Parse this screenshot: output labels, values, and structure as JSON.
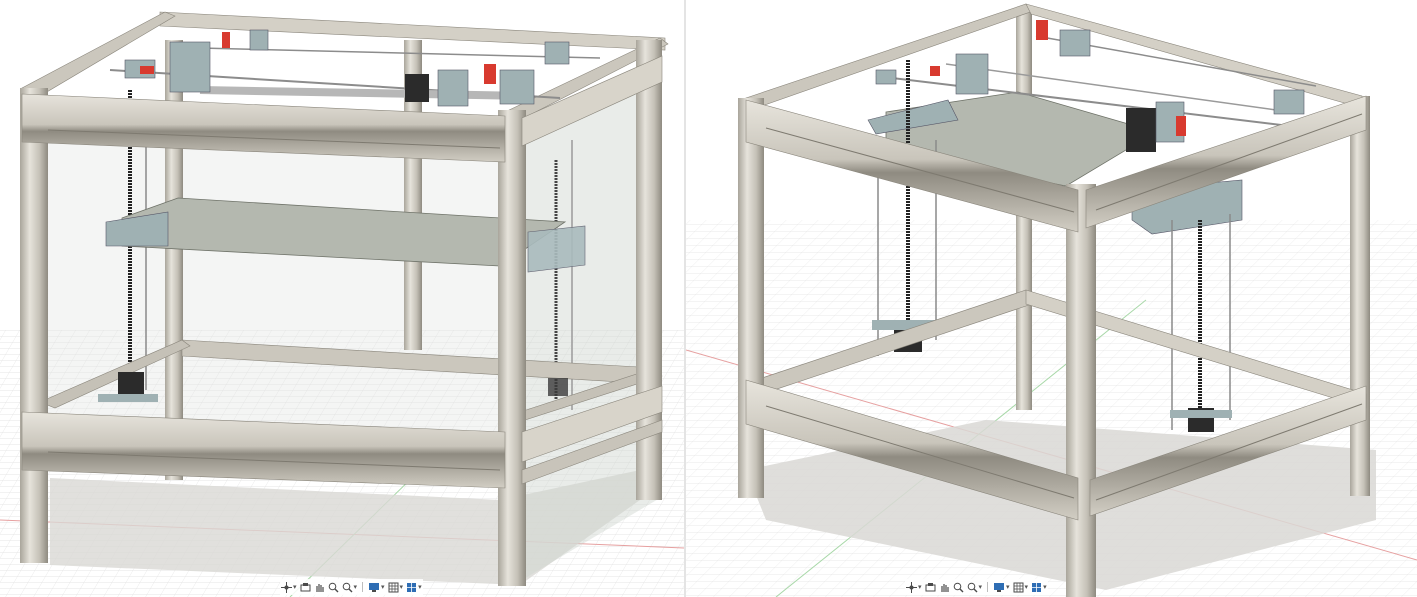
{
  "app": {
    "type": "cad-viewport",
    "panels": 2
  },
  "viewports": [
    {
      "id": "left",
      "view": "front-perspective",
      "enclosure_panels": "transparent",
      "navbar": [
        "orbit-icon",
        "look-at-icon",
        "pan-icon",
        "zoom-icon",
        "fit-icon",
        "display-settings-icon",
        "grid-settings-icon",
        "viewports-icon"
      ]
    },
    {
      "id": "right",
      "view": "iso-perspective",
      "enclosure_panels": "hidden",
      "navbar": [
        "orbit-icon",
        "look-at-icon",
        "pan-icon",
        "zoom-icon",
        "fit-icon",
        "display-settings-icon",
        "grid-settings-icon",
        "viewports-icon"
      ]
    }
  ],
  "colors": {
    "frame": "#c9c5bb",
    "frame_dark": "#8a867c",
    "frame_light": "#e5e2da",
    "panel": "rgba(205,210,205,0.35)",
    "bed": "#b4b8af",
    "bracket": "#9fb1b3",
    "motor": "#2b2b2b",
    "accent_red": "#d83a2f",
    "grid": "#d6d6d6",
    "axis_red": "#e6a0a0",
    "axis_green": "#9ed49e",
    "shadow": "#d9d8d5",
    "navbar_icon": "#4a4a4a",
    "navbar_blue": "#2e6db4"
  }
}
